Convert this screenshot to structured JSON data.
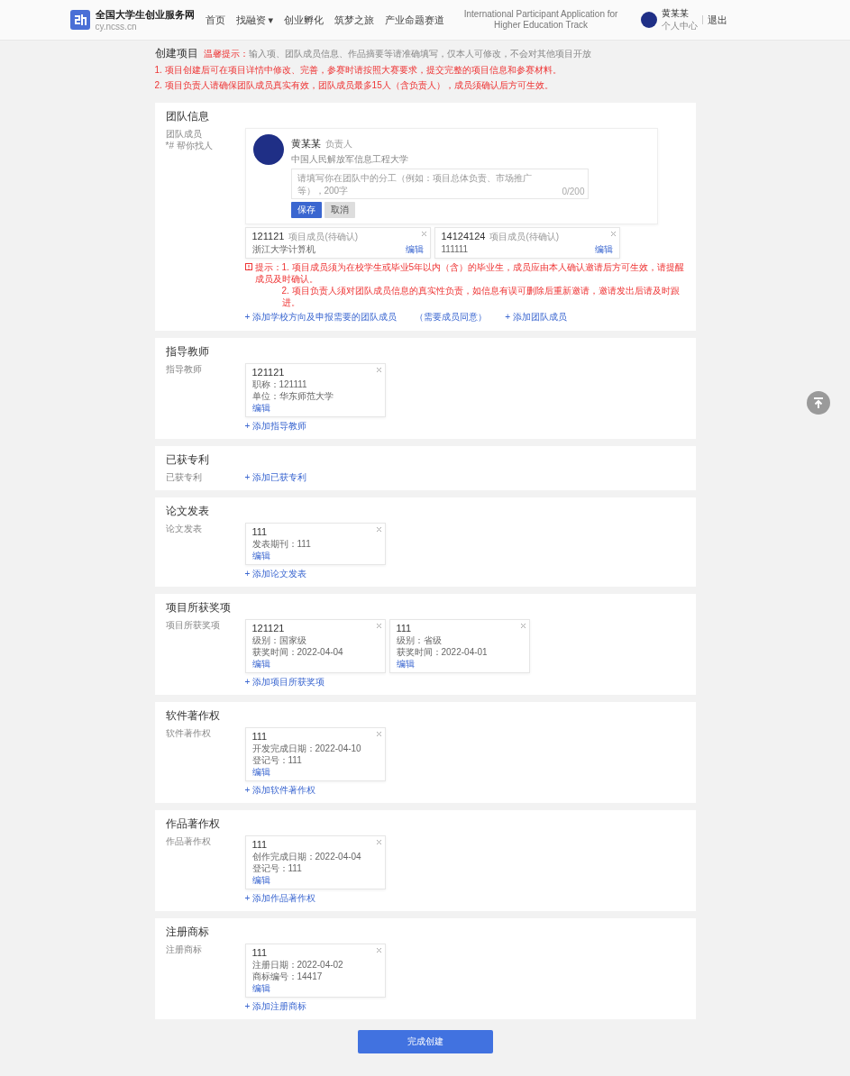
{
  "site": {
    "title": "全国大学生创业服务网",
    "subtitle": "cy.ncss.cn"
  },
  "nav": [
    {
      "label": "首页"
    },
    {
      "label": "找融资",
      "caret": "▾"
    },
    {
      "label": "创业孵化"
    },
    {
      "label": "筑梦之旅"
    },
    {
      "label": "产业命题赛道"
    },
    {
      "label": "International Participant Application for Higher Education Track",
      "kind": "small"
    }
  ],
  "user": {
    "name": "黄某某",
    "link": "个人中心",
    "logout": "退出"
  },
  "page": {
    "title": "创建项目",
    "tip_label": "温馨提示：",
    "tip": "输入项、团队成员信息、作品摘要等请准确填写，仅本人可修改，不会对其他项目开放"
  },
  "notes": [
    "1. 项目创建后可在项目详情中修改、完善，参赛时请按照大赛要求，提交完整的项目信息和参赛材料。",
    "2. 项目负责人请确保团队成员真实有效，团队成员最多15人（含负责人），成员须确认后方可生效。"
  ],
  "sections": [
    {
      "kind": "team",
      "title": "团队信息",
      "labels": [
        "团队成员",
        "*# 帮你找人"
      ],
      "leader": {
        "name": "黄某某",
        "role": "负责人",
        "school": "中国人民解放军信息工程大学",
        "placeholder": "请填写你在团队中的分工（例如：项目总体负责、市场推广等），200字",
        "counter": "0/200",
        "save": "保存",
        "cancel": "取消"
      },
      "members": [
        {
          "name": "121121",
          "role": "项目成员(待确认)",
          "detail": "浙江大学计算机",
          "edit": "编辑"
        },
        {
          "name": "14124124",
          "role": "项目成员(待确认)",
          "detail": "111111",
          "edit": "编辑"
        }
      ],
      "warning": [
        "提示：1. 项目成员须为在校学生或毕业5年以内（含）的毕业生，成员应由本人确认邀请后方可生效，请提醒成员及时确认。",
        "2. 项目负责人须对团队成员信息的真实性负责，如信息有误可删除后重新邀请，邀请发出后请及时跟进。"
      ],
      "links": [
        {
          "text": "+ 添加学校方向及申报需要的团队成员",
          "note": "（需要成员同意）"
        },
        {
          "text": "+ 添加团队成员"
        }
      ]
    },
    {
      "kind": "list",
      "title": "指导教师",
      "label": "指导教师",
      "cards": [
        {
          "title": "121121",
          "lines": [
            "职称：121111",
            "单位：华东师范大学"
          ],
          "edit": "编辑"
        }
      ],
      "add": "+ 添加指导教师"
    },
    {
      "kind": "list",
      "title": "已获专利",
      "label": "已获专利",
      "add": "+ 添加已获专利"
    },
    {
      "kind": "list",
      "title": "论文发表",
      "label": "论文发表",
      "cards": [
        {
          "title": "111",
          "lines": [
            "发表期刊：111"
          ],
          "edit": "编辑"
        }
      ],
      "add": "+ 添加论文发表"
    },
    {
      "kind": "list",
      "title": "项目所获奖项",
      "label": "项目所获奖项",
      "cards": [
        {
          "title": "121121",
          "lines": [
            "级别：国家级",
            "获奖时间：2022-04-04"
          ],
          "edit": "编辑"
        },
        {
          "title": "111",
          "lines": [
            "级别：省级",
            "获奖时间：2022-04-01"
          ],
          "edit": "编辑"
        }
      ],
      "add": "+ 添加项目所获奖项"
    },
    {
      "kind": "list",
      "title": "软件著作权",
      "label": "软件著作权",
      "cards": [
        {
          "title": "111",
          "lines": [
            "开发完成日期：2022-04-10",
            "登记号：111"
          ],
          "edit": "编辑"
        }
      ],
      "add": "+ 添加软件著作权"
    },
    {
      "kind": "list",
      "title": "作品著作权",
      "label": "作品著作权",
      "cards": [
        {
          "title": "111",
          "lines": [
            "创作完成日期：2022-04-04",
            "登记号：111"
          ],
          "edit": "编辑"
        }
      ],
      "add": "+ 添加作品著作权"
    },
    {
      "kind": "list",
      "title": "注册商标",
      "label": "注册商标",
      "cards": [
        {
          "title": "111",
          "lines": [
            "注册日期：2022-04-02",
            "商标编号：14417"
          ],
          "edit": "编辑"
        }
      ],
      "add": "+ 添加注册商标"
    }
  ],
  "submit": "完成创建"
}
